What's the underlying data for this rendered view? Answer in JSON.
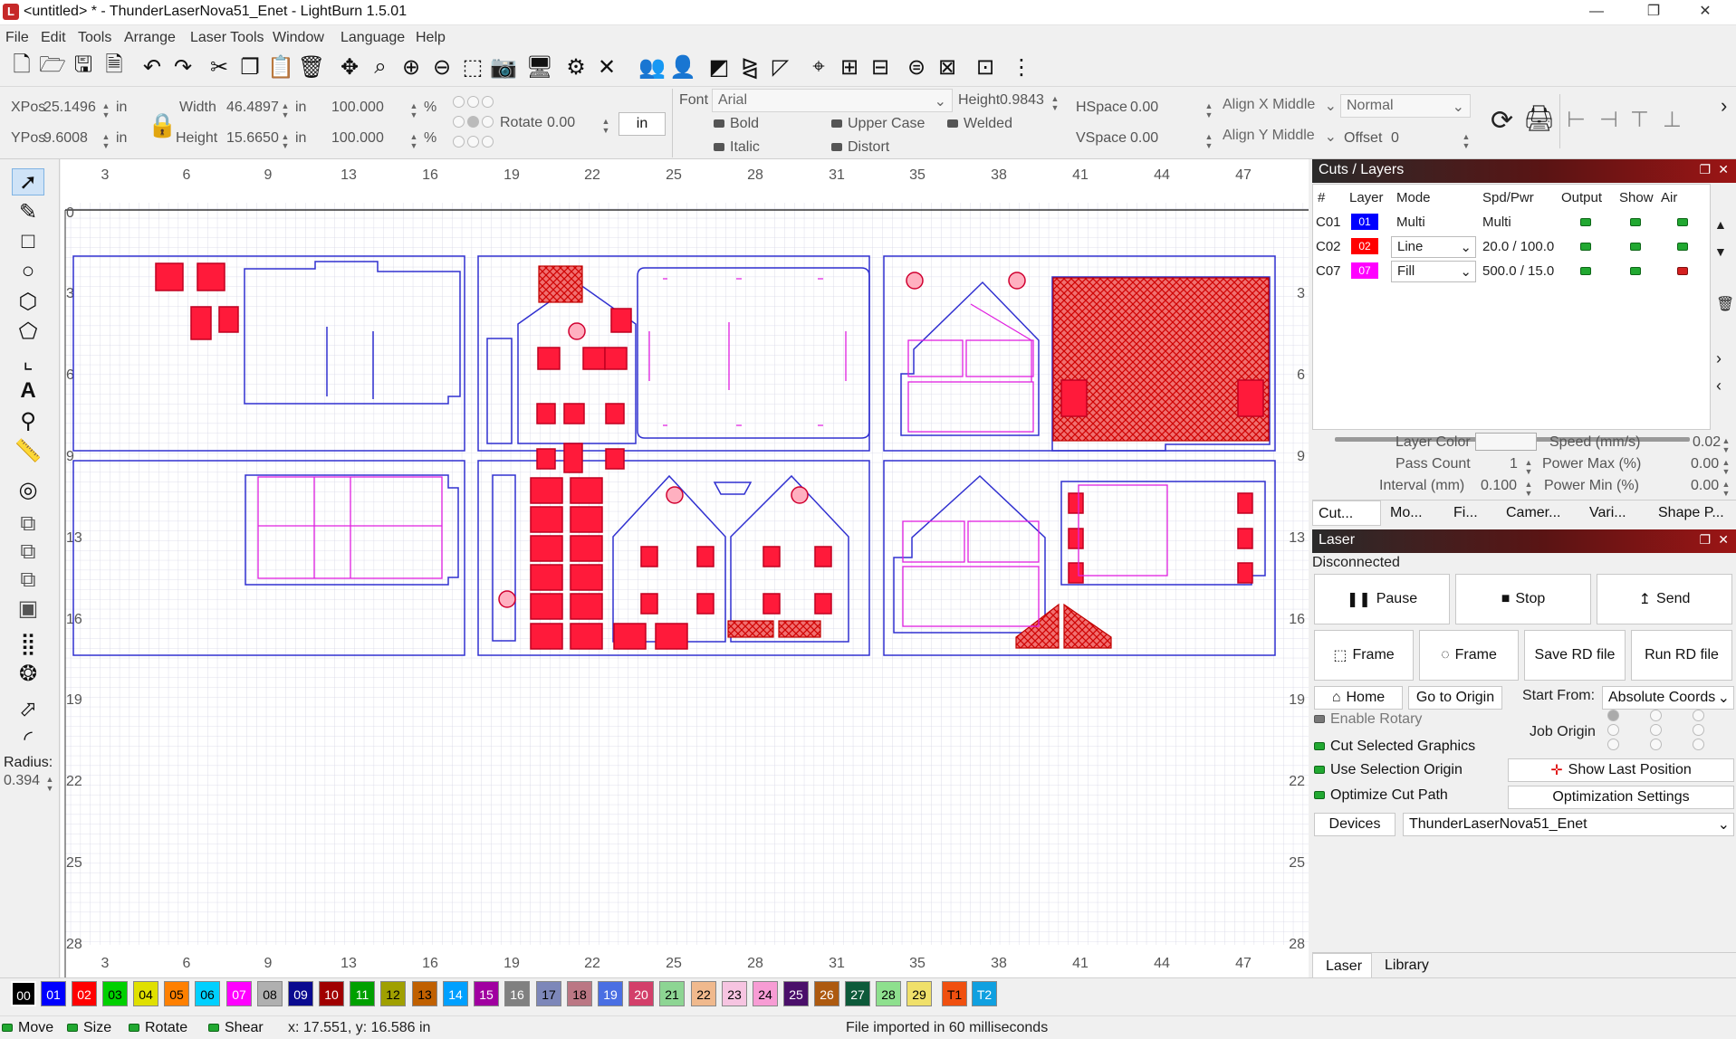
{
  "window": {
    "title": "<untitled> * - ThunderLaserNova51_Enet - LightBurn 1.5.01",
    "app_icon": "lightburn-icon",
    "minimize": "—",
    "maximize": "❐",
    "close": "✕"
  },
  "menu": [
    "File",
    "Edit",
    "Tools",
    "Arrange",
    "Laser Tools",
    "Window",
    "Language",
    "Help"
  ],
  "toolbar_icons": [
    "new-file-icon",
    "open-file-icon",
    "save-file-icon",
    "save-as-icon",
    "undo-icon",
    "redo-icon",
    "cut-icon",
    "copy-icon",
    "paste-icon",
    "delete-icon",
    "move-icon",
    "zoom-icon",
    "zoom-in-icon",
    "zoom-out-icon",
    "zoom-frame-icon",
    "camera-icon",
    "monitor-icon",
    "settings-icon",
    "tools-icon",
    "group-icon",
    "ungroup-icon",
    "align-icon",
    "mirror-icon",
    "flip-icon",
    "target-icon",
    "distribute-icon",
    "dock-icon",
    "move-tool-icon",
    "resize-icon",
    "spacing-icon",
    "more-icon"
  ],
  "props": {
    "xpos_label": "XPos",
    "xpos": "25.1496",
    "ypos_label": "YPos",
    "ypos": "9.6008",
    "unit": "in",
    "width_label": "Width",
    "width": "46.4897",
    "height_label": "Height",
    "height": "15.6650",
    "scale_w": "100.000",
    "scale_h": "100.000",
    "pct": "%",
    "rotate_label": "Rotate",
    "rotate": "0.00",
    "unit_btn": "in",
    "font_label": "Font",
    "font": "Arial",
    "font_height_label": "Height",
    "font_height": "0.9843",
    "bold": "Bold",
    "italic": "Italic",
    "upper_case": "Upper Case",
    "distort": "Distort",
    "welded": "Welded",
    "hspace_label": "HSpace",
    "hspace": "0.00",
    "vspace_label": "VSpace",
    "vspace": "0.00",
    "align_x": "Align X Middle",
    "align_y": "Align Y Middle",
    "mode": "Normal",
    "offset_label": "Offset",
    "offset": "0"
  },
  "left_tools": [
    "select-icon",
    "draw-lines-icon",
    "rectangle-icon",
    "ellipse-icon",
    "polygon-icon",
    "polygon-edit-icon",
    "crop-icon",
    "text-icon",
    "position-icon",
    "measure-icon",
    "offset-icon",
    "weld-icon",
    "union-icon",
    "subtract-icon",
    "intersect-icon",
    "grid-array-icon",
    "circular-array-icon",
    "corner-round-icon",
    "corner-chamfer-icon"
  ],
  "radius": {
    "label": "Radius:",
    "value": "0.394"
  },
  "ruler": {
    "x_ticks": [
      "3",
      "6",
      "9",
      "13",
      "16",
      "19",
      "22",
      "25",
      "28",
      "31",
      "35",
      "38",
      "41",
      "44",
      "47"
    ],
    "y_ticks": [
      "0",
      "3",
      "6",
      "9",
      "13",
      "16",
      "19",
      "22",
      "25",
      "28"
    ]
  },
  "cuts_layers": {
    "title": "Cuts / Layers",
    "headers": [
      "#",
      "Layer",
      "Mode",
      "Spd/Pwr",
      "Output",
      "Show",
      "Air"
    ],
    "rows": [
      {
        "id": "C01",
        "layer": "01",
        "color": "#0000ff",
        "mode": "Multi",
        "spd_pwr": "Multi",
        "output": true,
        "show": true,
        "air": "on"
      },
      {
        "id": "C02",
        "layer": "02",
        "color": "#ff0000",
        "mode": "Line",
        "spd_pwr": "20.0 / 100.0",
        "output": true,
        "show": true,
        "air": "on"
      },
      {
        "id": "C07",
        "layer": "07",
        "color": "#ff00ff",
        "mode": "Fill",
        "spd_pwr": "500.0 / 15.0",
        "output": true,
        "show": true,
        "air": "off"
      }
    ],
    "layer_color_label": "Layer Color",
    "speed_label": "Speed (mm/s)",
    "speed": "0.02",
    "pass_count_label": "Pass Count",
    "pass_count": "1",
    "power_max_label": "Power Max (%)",
    "power_max": "0.00",
    "interval_label": "Interval (mm)",
    "interval": "0.100",
    "power_min_label": "Power Min (%)",
    "power_min": "0.00",
    "tabs": [
      "Cut...",
      "Mo...",
      "Fi...",
      "Camer...",
      "Vari...",
      "Shape P..."
    ]
  },
  "laser": {
    "title": "Laser",
    "status": "Disconnected",
    "pause": "Pause",
    "stop": "Stop",
    "send": "Send",
    "frame1": "Frame",
    "frame2": "Frame",
    "save_rd": "Save RD file",
    "run_rd": "Run RD file",
    "home": "Home",
    "go_origin": "Go to Origin",
    "start_from_label": "Start From:",
    "start_from": "Absolute Coords",
    "enable_rotary": "Enable Rotary",
    "job_origin": "Job Origin",
    "cut_selected": "Cut Selected Graphics",
    "use_selection_origin": "Use Selection Origin",
    "show_last_position": "Show Last Position",
    "optimize_cut_path": "Optimize Cut Path",
    "optimization_settings": "Optimization Settings",
    "devices": "Devices",
    "device": "ThunderLaserNova51_Enet",
    "bottom_tabs": [
      "Laser",
      "Library"
    ]
  },
  "palette": [
    {
      "label": "00",
      "color": "#000000",
      "fg": "#ffffff"
    },
    {
      "label": "01",
      "color": "#0000ff",
      "fg": "#ffffff"
    },
    {
      "label": "02",
      "color": "#ff0000",
      "fg": "#ffffff"
    },
    {
      "label": "03",
      "color": "#00d000",
      "fg": "#000000"
    },
    {
      "label": "04",
      "color": "#e0e000",
      "fg": "#000000"
    },
    {
      "label": "05",
      "color": "#ff8000",
      "fg": "#000000"
    },
    {
      "label": "06",
      "color": "#00d0ff",
      "fg": "#000000"
    },
    {
      "label": "07",
      "color": "#ff00ff",
      "fg": "#ffffff"
    },
    {
      "label": "08",
      "color": "#b0b0b0",
      "fg": "#000000"
    },
    {
      "label": "09",
      "color": "#0a0a90",
      "fg": "#ffffff"
    },
    {
      "label": "10",
      "color": "#a00000",
      "fg": "#ffffff"
    },
    {
      "label": "11",
      "color": "#00a000",
      "fg": "#ffffff"
    },
    {
      "label": "12",
      "color": "#a0a000",
      "fg": "#000000"
    },
    {
      "label": "13",
      "color": "#c06000",
      "fg": "#000000"
    },
    {
      "label": "14",
      "color": "#00a0ff",
      "fg": "#ffffff"
    },
    {
      "label": "15",
      "color": "#a000a0",
      "fg": "#ffffff"
    },
    {
      "label": "16",
      "color": "#808080",
      "fg": "#ffffff"
    },
    {
      "label": "17",
      "color": "#7d87b9",
      "fg": "#000000"
    },
    {
      "label": "18",
      "color": "#bb7784",
      "fg": "#000000"
    },
    {
      "label": "19",
      "color": "#4a6fe3",
      "fg": "#ffffff"
    },
    {
      "label": "20",
      "color": "#d33f6a",
      "fg": "#ffffff"
    },
    {
      "label": "21",
      "color": "#8dd593",
      "fg": "#000000"
    },
    {
      "label": "22",
      "color": "#f0b98d",
      "fg": "#000000"
    },
    {
      "label": "23",
      "color": "#f6c4e1",
      "fg": "#000000"
    },
    {
      "label": "24",
      "color": "#f79cd4",
      "fg": "#000000"
    },
    {
      "label": "25",
      "color": "#4a0f6a",
      "fg": "#ffffff"
    },
    {
      "label": "26",
      "color": "#ad5a10",
      "fg": "#ffffff"
    },
    {
      "label": "27",
      "color": "#0d5a3a",
      "fg": "#ffffff"
    },
    {
      "label": "28",
      "color": "#8ee08e",
      "fg": "#000000"
    },
    {
      "label": "29",
      "color": "#f0e06a",
      "fg": "#000000"
    },
    {
      "label": "T1",
      "color": "#f05010",
      "fg": "#000000"
    },
    {
      "label": "T2",
      "color": "#10a0e0",
      "fg": "#ffffff"
    }
  ],
  "status": {
    "move": "Move",
    "size": "Size",
    "rotate": "Rotate",
    "shear": "Shear",
    "coords": "x: 17.551, y: 16.586 in",
    "message": "File imported in 60 milliseconds"
  }
}
